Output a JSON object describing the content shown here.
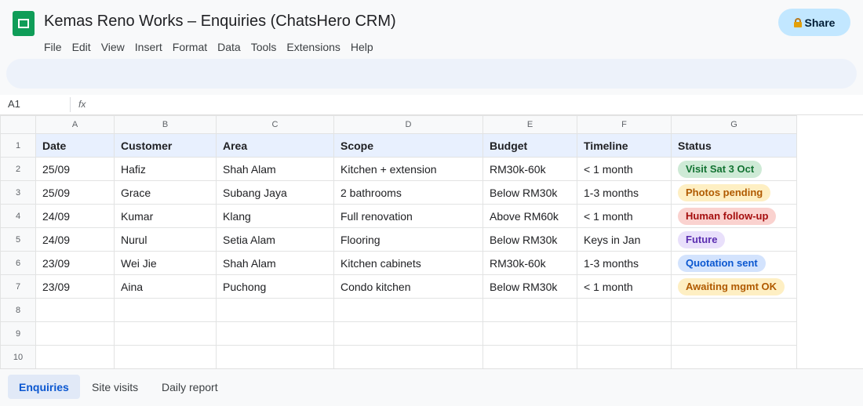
{
  "app": {
    "title": "Kemas Reno Works – Enquiries (ChatsHero CRM)",
    "share_label": "Share",
    "brand_color": "#0f9d58",
    "accent_color": "#c2e7ff",
    "icons": [
      "sheets-logo-icon",
      "lock-icon",
      "fx-icon"
    ]
  },
  "menu": [
    "File",
    "Edit",
    "View",
    "Insert",
    "Format",
    "Data",
    "Tools",
    "Extensions",
    "Help"
  ],
  "formula_bar": {
    "cell_ref": "A1",
    "fx_label": "fx",
    "value": ""
  },
  "grid": {
    "columns": [
      "A",
      "B",
      "C",
      "D",
      "E",
      "F",
      "G"
    ],
    "row_numbers": [
      "1",
      "2",
      "3",
      "4",
      "5",
      "6",
      "7",
      "8",
      "9",
      "10"
    ],
    "headers": [
      "Date",
      "Customer",
      "Area",
      "Scope",
      "Budget",
      "Timeline",
      "Status"
    ],
    "rows": [
      {
        "date": "25/09",
        "customer": "Hafiz",
        "area": "Shah Alam",
        "scope": "Kitchen + extension",
        "budget": "RM30k-60k",
        "timeline": "< 1 month",
        "status": "Visit Sat 3 Oct",
        "status_bg": "#ceead6",
        "status_fg": "#137333"
      },
      {
        "date": "25/09",
        "customer": "Grace",
        "area": "Subang Jaya",
        "scope": "2 bathrooms",
        "budget": "Below RM30k",
        "timeline": "1-3 months",
        "status": "Photos pending",
        "status_bg": "#feefc3",
        "status_fg": "#b05a00"
      },
      {
        "date": "24/09",
        "customer": "Kumar",
        "area": "Klang",
        "scope": "Full renovation",
        "budget": "Above RM60k",
        "timeline": "< 1 month",
        "status": "Human follow-up",
        "status_bg": "#fad2cf",
        "status_fg": "#a50e0e"
      },
      {
        "date": "24/09",
        "customer": "Nurul",
        "area": "Setia Alam",
        "scope": "Flooring",
        "budget": "Below RM30k",
        "timeline": "Keys in Jan",
        "status": "Future",
        "status_bg": "#e9e0fb",
        "status_fg": "#5b2db0"
      },
      {
        "date": "23/09",
        "customer": "Wei Jie",
        "area": "Shah Alam",
        "scope": "Kitchen cabinets",
        "budget": "RM30k-60k",
        "timeline": "1-3 months",
        "status": "Quotation sent",
        "status_bg": "#d3e3fd",
        "status_fg": "#0b57d0"
      },
      {
        "date": "23/09",
        "customer": "Aina",
        "area": "Puchong",
        "scope": "Condo kitchen",
        "budget": "Below RM30k",
        "timeline": "< 1 month",
        "status": "Awaiting mgmt OK",
        "status_bg": "#feefc3",
        "status_fg": "#b05a00"
      }
    ]
  },
  "sheet_tabs": [
    {
      "label": "Enquiries",
      "active": true
    },
    {
      "label": "Site visits",
      "active": false
    },
    {
      "label": "Daily report",
      "active": false
    }
  ]
}
